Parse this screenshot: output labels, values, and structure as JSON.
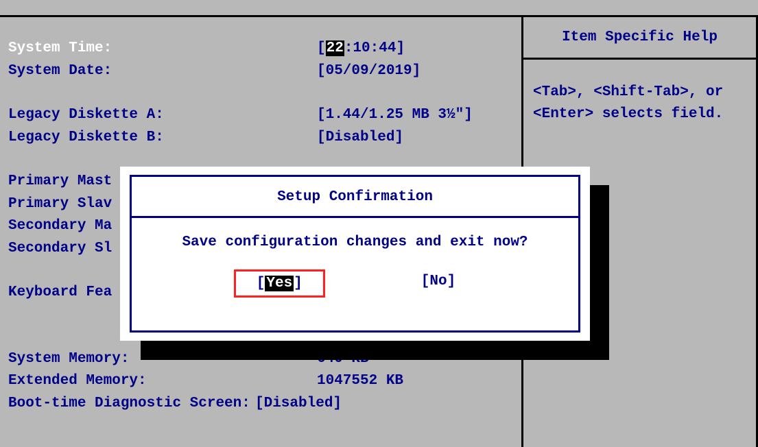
{
  "main": {
    "systemTime": {
      "label": "System Time:",
      "hour": "22",
      "rest": ":10:44"
    },
    "systemDate": {
      "label": "System Date:",
      "value": "[05/09/2019]"
    },
    "disketteA": {
      "label": "Legacy Diskette A:",
      "value": "[1.44/1.25 MB  3½\"]"
    },
    "disketteB": {
      "label": "Legacy Diskette B:",
      "value": "[Disabled]"
    },
    "primaryMaster": {
      "label": "Primary Mast"
    },
    "primarySlave": {
      "label": "Primary Slav"
    },
    "secondaryMaster": {
      "label": "Secondary Ma"
    },
    "secondarySlave": {
      "label": "Secondary Sl"
    },
    "keyboard": {
      "label": "Keyboard Fea"
    },
    "systemMemory": {
      "label": "System Memory:",
      "value": "640 KB"
    },
    "extendedMemory": {
      "label": "Extended Memory:",
      "value": "1047552 KB"
    },
    "bootDiag": {
      "label": "Boot-time Diagnostic Screen:",
      "value": "[Disabled]"
    }
  },
  "help": {
    "title": "Item Specific Help",
    "body": "<Tab>, <Shift-Tab>, or <Enter> selects field."
  },
  "dialog": {
    "title": "Setup Confirmation",
    "message": "Save configuration changes and exit now?",
    "yes": "Yes",
    "no": "[No]"
  }
}
